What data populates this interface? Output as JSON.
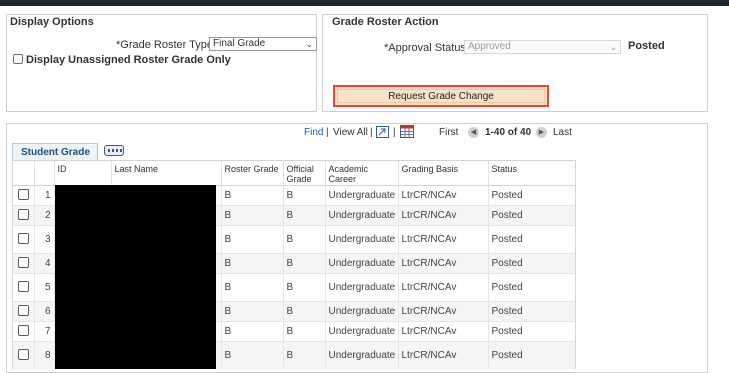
{
  "display_options": {
    "title": "Display Options",
    "roster_type_label": "*Grade Roster Type",
    "roster_type_value": "Final Grade",
    "unassigned_label": "Display Unassigned Roster Grade Only"
  },
  "grade_roster_action": {
    "title": "Grade Roster Action",
    "approval_label": "*Approval Status",
    "approval_value": "Approved",
    "posted_label": "Posted",
    "request_button": "Request Grade Change"
  },
  "grid_nav": {
    "find": "Find",
    "sep": "|",
    "view_all": "View All",
    "first": "First",
    "range": "1-40 of 40",
    "last": "Last"
  },
  "tab": {
    "label": "Student Grade"
  },
  "table": {
    "columns": [
      "ID",
      "Last Name",
      "Roster Grade",
      "Official Grade",
      "Academic Career",
      "Grading Basis",
      "Status"
    ],
    "rows": [
      {
        "num": "1",
        "id": "",
        "last_name": "",
        "roster_grade": "B",
        "official_grade": "B",
        "career": "Undergraduate",
        "basis": "LtrCR/NCAv",
        "status": "Posted"
      },
      {
        "num": "2",
        "id": "",
        "last_name": "",
        "roster_grade": "B",
        "official_grade": "B",
        "career": "Undergraduate",
        "basis": "LtrCR/NCAv",
        "status": "Posted"
      },
      {
        "num": "3",
        "id": "",
        "last_name": "",
        "roster_grade": "B",
        "official_grade": "B",
        "career": "Undergraduate",
        "basis": "LtrCR/NCAv",
        "status": "Posted"
      },
      {
        "num": "4",
        "id": "",
        "last_name": "",
        "roster_grade": "B",
        "official_grade": "B",
        "career": "Undergraduate",
        "basis": "LtrCR/NCAv",
        "status": "Posted"
      },
      {
        "num": "5",
        "id": "",
        "last_name": "",
        "roster_grade": "B",
        "official_grade": "B",
        "career": "Undergraduate",
        "basis": "LtrCR/NCAv",
        "status": "Posted"
      },
      {
        "num": "6",
        "id": "",
        "last_name": "",
        "roster_grade": "B",
        "official_grade": "B",
        "career": "Undergraduate",
        "basis": "LtrCR/NCAv",
        "status": "Posted"
      },
      {
        "num": "7",
        "id": "",
        "last_name": "",
        "roster_grade": "B",
        "official_grade": "B",
        "career": "Undergraduate",
        "basis": "LtrCR/NCAv",
        "status": "Posted"
      },
      {
        "num": "8",
        "id": "",
        "last_name": "",
        "roster_grade": "B",
        "official_grade": "B",
        "career": "Undergraduate",
        "basis": "LtrCR/NCAv",
        "status": "Posted"
      }
    ]
  },
  "colors": {
    "link": "#1d5c95",
    "button_bg": "#f8e2c9",
    "button_outline": "#e8453c",
    "redaction": "#000000"
  },
  "icons": [
    "chevron-down-icon",
    "zoom-icon",
    "download-spreadsheet-icon",
    "first-arrow-icon",
    "next-arrow-icon",
    "personalize-grid-icon"
  ]
}
